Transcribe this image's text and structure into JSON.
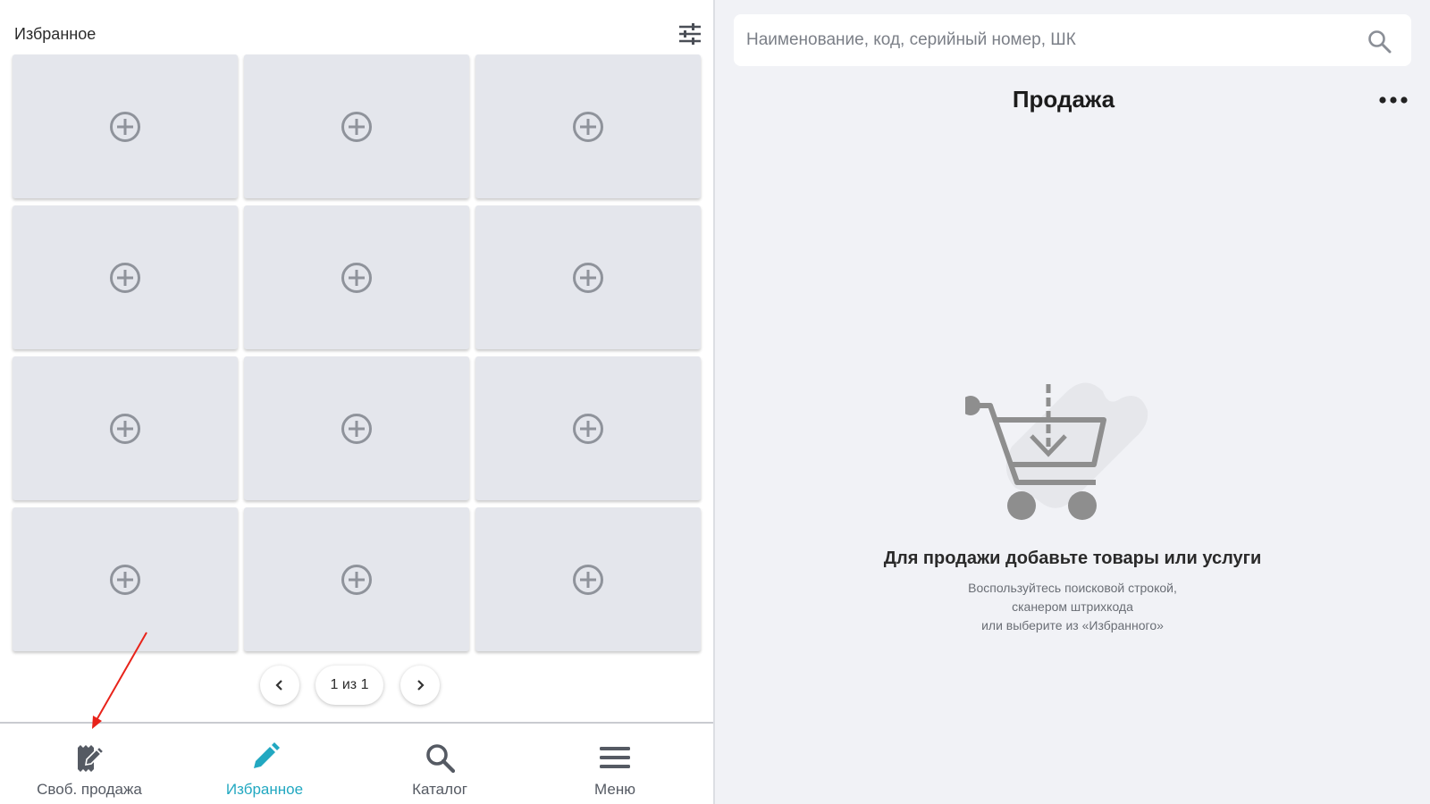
{
  "favorites": {
    "title": "Избранное",
    "tiles": [
      {
        "icon": "add-circle-icon"
      },
      {
        "icon": "add-circle-icon"
      },
      {
        "icon": "add-circle-icon"
      },
      {
        "icon": "add-circle-icon"
      },
      {
        "icon": "add-circle-icon"
      },
      {
        "icon": "add-circle-icon"
      },
      {
        "icon": "add-circle-icon"
      },
      {
        "icon": "add-circle-icon"
      },
      {
        "icon": "add-circle-icon"
      },
      {
        "icon": "add-circle-icon"
      },
      {
        "icon": "add-circle-icon"
      },
      {
        "icon": "add-circle-icon"
      }
    ],
    "pagination": {
      "label": "1 из 1"
    }
  },
  "nav": {
    "items": [
      {
        "label": "Своб. продажа",
        "icon": "free-sale-icon"
      },
      {
        "label": "Избранное",
        "icon": "pencil-icon",
        "active": true
      },
      {
        "label": "Каталог",
        "icon": "search-icon"
      },
      {
        "label": "Меню",
        "icon": "menu-icon"
      }
    ]
  },
  "search": {
    "placeholder": "Наименование, код, серийный номер, ШК"
  },
  "sale": {
    "title": "Продажа",
    "empty_title": "Для продажи добавьте товары или услуги",
    "empty_hint": [
      "Воспользуйтесь поисковой строкой,",
      "сканером штрихкода",
      "или выберите из «Избранного»"
    ]
  },
  "colors": {
    "accent": "#22a8c1",
    "tile": "#e4e6ec",
    "panel": "#f1f2f6",
    "annotation": "#e8231a"
  }
}
